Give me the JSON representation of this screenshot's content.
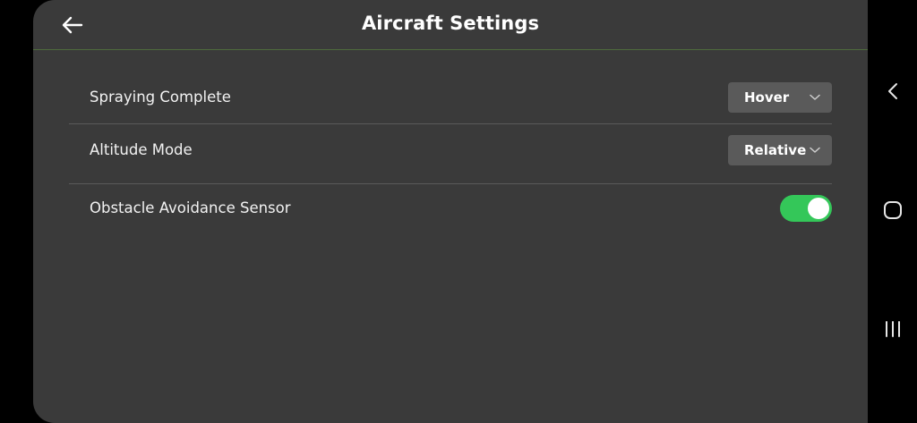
{
  "header": {
    "title": "Aircraft Settings",
    "back_icon": "arrow-left-icon"
  },
  "settings": [
    {
      "label": "Spraying Complete",
      "control": "dropdown",
      "value": "Hover"
    },
    {
      "label": "Altitude Mode",
      "control": "dropdown",
      "value": "Relative"
    },
    {
      "label": "Obstacle Avoidance Sensor",
      "control": "toggle",
      "on": true
    }
  ],
  "system_nav": {
    "back_icon": "chevron-left-icon",
    "home_icon": "rounded-square-icon",
    "recents_icon": "three-bars-icon"
  },
  "colors": {
    "panel_background": "#3a3a3a",
    "toggle_on": "#34c759",
    "dropdown_background": "#5a5a5a",
    "header_divider": "#4e6b3c"
  }
}
